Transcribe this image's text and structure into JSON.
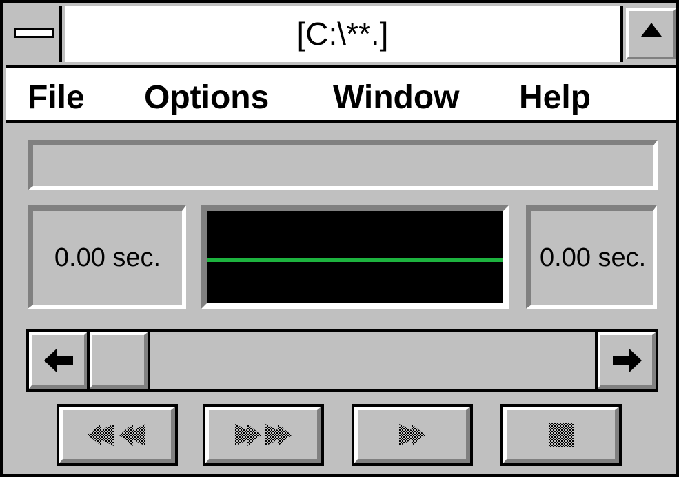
{
  "window": {
    "title": "[C:\\**.]",
    "system_menu_icon": "system-menu-bar",
    "maximize_icon": "up-triangle"
  },
  "menu": [
    {
      "label": "File"
    },
    {
      "label": "Options"
    },
    {
      "label": "Window"
    },
    {
      "label": "Help"
    }
  ],
  "status_text": "",
  "position_readout": "0.00 sec.",
  "length_readout": "0.00 sec.",
  "waveform": {
    "line_color": "#1db33f",
    "background": "#000000"
  },
  "scrollbar": {
    "position": 0.0,
    "left_icon": "left-arrow-icon",
    "right_icon": "right-arrow-icon"
  },
  "transport": [
    {
      "name": "rewind",
      "icon": "rewind-icon"
    },
    {
      "name": "fast-forward",
      "icon": "fast-forward-icon"
    },
    {
      "name": "play",
      "icon": "play-icon"
    },
    {
      "name": "stop",
      "icon": "stop-icon"
    }
  ],
  "colors": {
    "face": "#c0c0c0",
    "highlight": "#ffffff",
    "shadow": "#808080",
    "frame": "#000000"
  }
}
